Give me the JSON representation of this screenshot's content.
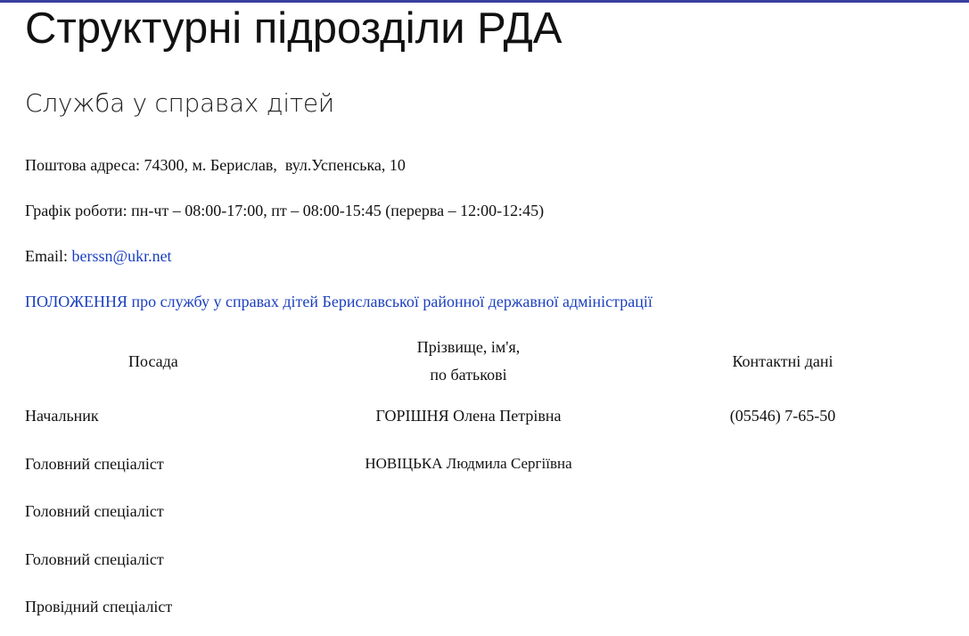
{
  "page": {
    "title": "Структурні підрозділи РДА",
    "section_title": "Служба у справах дітей"
  },
  "info": {
    "address_label": "Поштова адреса: ",
    "address_value": "74300, м. Берислав,  вул.Успенська, 10",
    "schedule_label": "Графік роботи: ",
    "schedule_value": "пн-чт – 08:00-17:00, пт – 08:00-15:45 (перерва – 12:00-12:45)",
    "email_label": "Email: ",
    "email_value": "berssn@ukr.net",
    "regulation_link": "ПОЛОЖЕННЯ про службу у справах дітей Бериславської районної державної адміністрації"
  },
  "table": {
    "headers": {
      "position": "Посада",
      "name_line1": "Прізвище, ім'я,",
      "name_line2": "по батькові",
      "contact": "Контактні дані"
    },
    "rows": [
      {
        "position": "Начальник",
        "name": "ГОРІШНЯ Олена Петрівна",
        "contact": "(05546) 7-65-50"
      },
      {
        "position": "Головний спеціаліст",
        "name": "НОВІЦЬКА Людмила Сергіївна",
        "contact": ""
      },
      {
        "position": "Головний спеціаліст",
        "name": "",
        "contact": ""
      },
      {
        "position": "Головний спеціаліст",
        "name": "",
        "contact": ""
      },
      {
        "position": "Провідний спеціаліст",
        "name": "",
        "contact": ""
      }
    ]
  },
  "colors": {
    "accent_border": "#3a3f9e",
    "link": "#1a3fbf"
  }
}
